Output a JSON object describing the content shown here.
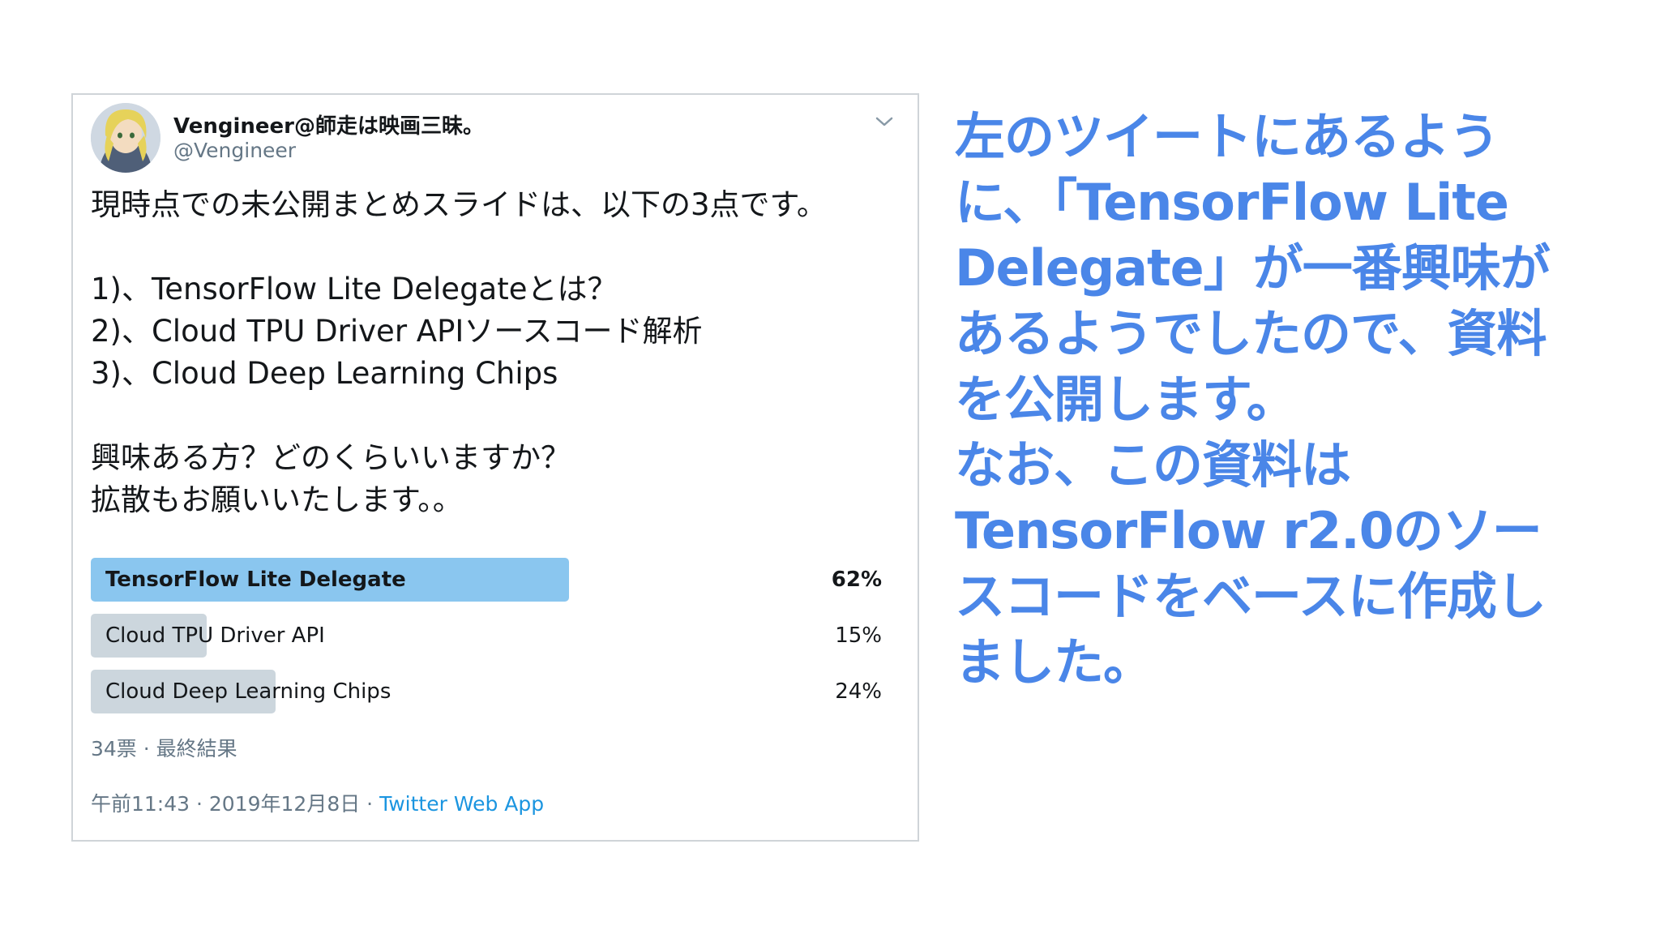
{
  "tweet": {
    "display_name": "Vengineer@師走は映画三昧。",
    "handle": "@Vengineer",
    "menu_icon": "chevron-down-icon",
    "body_lines": [
      "現時点での未公開まとめスライドは、以下の3点です。",
      "",
      "1)、TensorFlow Lite Delegateとは？",
      "2)、Cloud TPU Driver APIソースコード解析",
      "3)、Cloud Deep Learning Chips",
      "",
      "興味ある方？どのくらいいますか？",
      "拡散もお願いいたします。。"
    ],
    "poll": {
      "options": [
        {
          "label": "TensorFlow Lite Delegate",
          "percent_text": "62%",
          "fraction": 0.62,
          "winner": true
        },
        {
          "label": "Cloud TPU Driver API",
          "percent_text": "15%",
          "fraction": 0.15,
          "winner": false
        },
        {
          "label": "Cloud Deep Learning Chips",
          "percent_text": "24%",
          "fraction": 0.24,
          "winner": false
        }
      ],
      "meta": "34票 · 最終結果"
    },
    "footer": {
      "timestamp": "午前11:43 · 2019年12月8日 · ",
      "source": "Twitter Web App"
    }
  },
  "caption_lines": [
    "左のツイートにあるよう",
    "に、「TensorFlow Lite",
    "Delegate」が一番興味が",
    "あるようでしたので、資料",
    "を公開します。",
    "なお、この資料は",
    "TensorFlow r2.0のソー",
    "スコードをベースに作成し",
    "ました。"
  ],
  "colors": {
    "caption": "#4a86e8",
    "poll_winner": "#8ac6ef",
    "poll_other": "#ccd6dd",
    "link": "#1b95e0"
  }
}
